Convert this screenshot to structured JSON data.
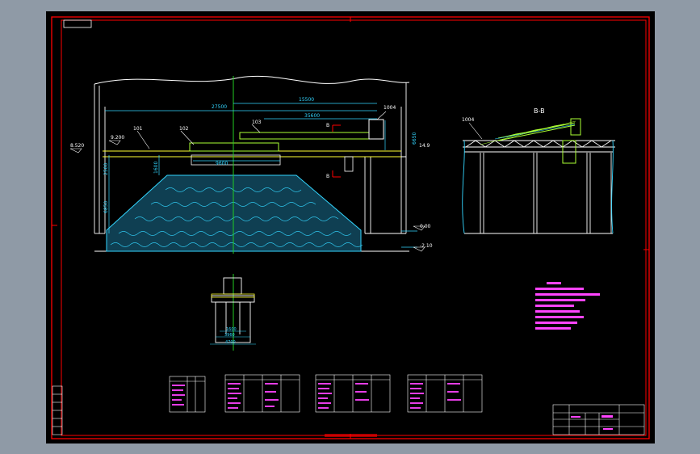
{
  "drawing": {
    "elevation_view": {
      "top_dims": [
        "27500",
        "15500",
        "35600"
      ],
      "part_labels": [
        "101",
        "102",
        "103",
        "1004"
      ],
      "section_mark": "B",
      "side_dims": [
        "2500",
        "1600",
        "6850",
        "6650"
      ],
      "left_levels": [
        "8.520",
        "9.200"
      ],
      "bottom_dim": "9600",
      "right_levels": [
        "14.9",
        "0.00",
        "-2.10"
      ]
    },
    "section_view": {
      "title": "B-B",
      "part_label": "1004"
    },
    "detail_view": {
      "dims": [
        "1600",
        "3960",
        "4700"
      ]
    },
    "colors": {
      "sheet": "#000000",
      "frame": "#ff0000",
      "structure": "#ffffff",
      "dimension": "#33d6ff",
      "note": "#ff44ff",
      "stockpile": "#33d6ff",
      "equipment": "#aaff33",
      "centerline": "#22cc22",
      "background": "#8f9aa6"
    }
  }
}
